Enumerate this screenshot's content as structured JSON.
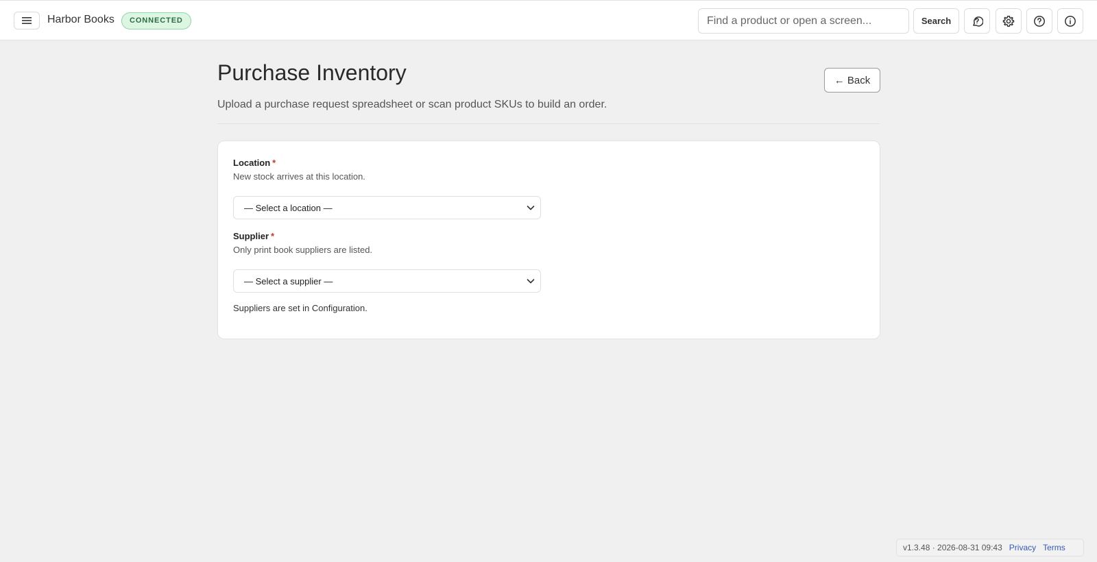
{
  "topbar": {
    "app_name": "Harbor Books",
    "status": "CONNECTED",
    "search_placeholder": "Find a product or open a screen...",
    "search_button": "Search",
    "icons": [
      "hamburger-menu-icon",
      "support-chat-icon",
      "gear-icon",
      "help-circle-icon",
      "info-circle-icon"
    ]
  },
  "page": {
    "title": "Purchase Inventory",
    "subtitle": "Upload a purchase request spreadsheet or scan product SKUs to build an order.",
    "back_label": "← Back"
  },
  "form": {
    "location": {
      "label": "Location",
      "required": "*",
      "help": "New stock arrives at this location.",
      "selected": "— Select a location —"
    },
    "supplier": {
      "label": "Supplier",
      "required": "*",
      "help": "Only print book suppliers are listed.",
      "selected": "— Select a supplier —"
    },
    "config_note": "Suppliers are set in Configuration."
  },
  "footer": {
    "version": "v1.3.48 · 2026-08-31 09:43",
    "privacy": "Privacy",
    "terms": "Terms"
  },
  "colors": {
    "status_bg": "#dcf6e3",
    "status_text": "#2c6b3e",
    "required": "#c0392b",
    "link": "#3558b8"
  }
}
